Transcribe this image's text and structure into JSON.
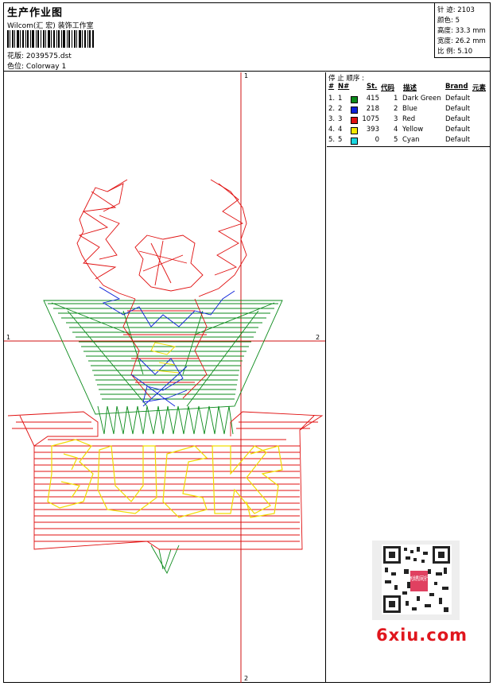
{
  "header": {
    "title": "生产作业图",
    "company": "Wilcom(汇 宏) 装饰工作室",
    "design_label": "花版:",
    "design_file": "2039575.dst",
    "colorway_label": "色位:",
    "colorway": "Colorway 1"
  },
  "stats": [
    {
      "label": "针 迹:",
      "value": "2103"
    },
    {
      "label": "颜色:",
      "value": "5"
    },
    {
      "label": "高度:",
      "value": "33.3 mm"
    },
    {
      "label": "宽度:",
      "value": "26.2 mm"
    },
    {
      "label": "比 例:",
      "value": "5.10"
    }
  ],
  "stop_sequence": {
    "title": "停 止 顺序 :",
    "columns": [
      "#",
      "N#",
      "St.",
      "代码",
      "描述",
      "Brand",
      "元素"
    ],
    "rows": [
      {
        "num": "1.",
        "n": "1",
        "stitches": "415",
        "code": "1",
        "desc": "Dark Green",
        "brand": "Default",
        "color": "#0a8a1a"
      },
      {
        "num": "2.",
        "n": "2",
        "stitches": "218",
        "code": "2",
        "desc": "Blue",
        "brand": "Default",
        "color": "#0b20d8"
      },
      {
        "num": "3.",
        "n": "3",
        "stitches": "1075",
        "code": "3",
        "desc": "Red",
        "brand": "Default",
        "color": "#e01010"
      },
      {
        "num": "4.",
        "n": "4",
        "stitches": "393",
        "code": "4",
        "desc": "Yellow",
        "brand": "Default",
        "color": "#f4e800"
      },
      {
        "num": "5.",
        "n": "5",
        "stitches": "0",
        "code": "5",
        "desc": "Cyan",
        "brand": "Default",
        "color": "#19d6e0"
      }
    ]
  },
  "axes": {
    "top": "1",
    "bottom": "2",
    "left": "1",
    "right": "2"
  },
  "watermark": {
    "text": "6xiu.com",
    "qr_label": "刺绣同行"
  }
}
